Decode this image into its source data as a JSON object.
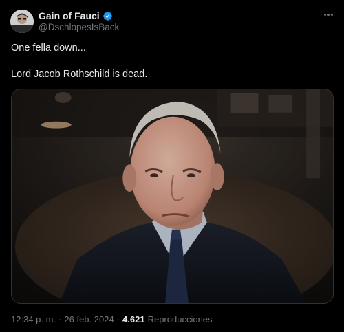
{
  "author": {
    "display_name": "Gain of Fauci",
    "handle": "@DschlopesIsBack",
    "verified": true,
    "verified_icon": "verified-badge-icon",
    "avatar_icon": "avatar"
  },
  "menu_icon": "more-options-icon",
  "tweet": {
    "line1": "One fella down...",
    "line2": "Lord Jacob Rothschild is dead."
  },
  "media": {
    "kind": "photo"
  },
  "meta": {
    "time": "12:34 p. m.",
    "separator": "·",
    "date": "26 feb. 2024",
    "views_count": "4.621",
    "views_label": "Reproducciones"
  },
  "colors": {
    "background": "#000000",
    "text": "#e7e9ea",
    "muted": "#71767b",
    "verified": "#1d9bf0",
    "border": "#2f3336"
  }
}
